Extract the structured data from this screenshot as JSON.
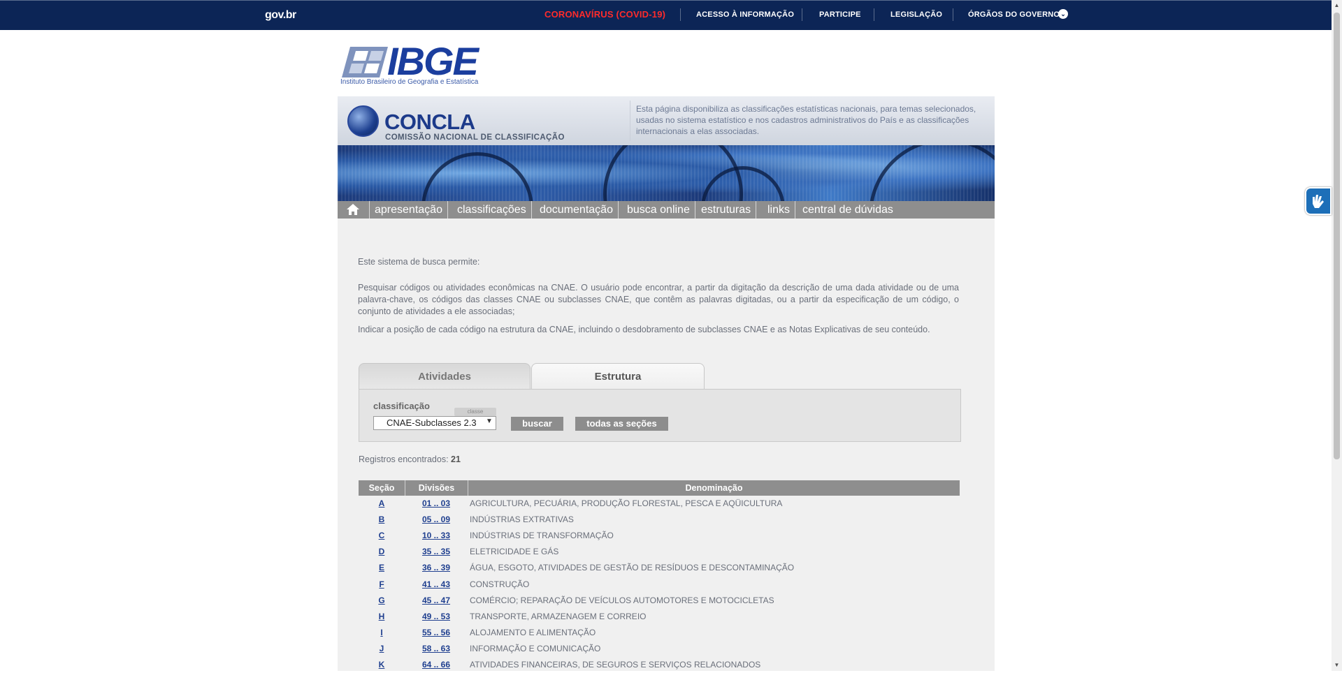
{
  "gov_bar": {
    "logo": "gov.br",
    "links": [
      "CORONAVÍRUS (COVID-19)",
      "ACESSO À INFORMAÇÃO",
      "PARTICIPE",
      "LEGISLAÇÃO",
      "ÓRGÃOS DO GOVERNO"
    ],
    "covid_color": "#ff2b2b",
    "bar_color": "#0c2556"
  },
  "ibge": {
    "name": "IBGE",
    "subtitle": "Instituto Brasileiro de Geografia e Estatística"
  },
  "concla": {
    "title": "CONCLA",
    "subtitle": "COMISSÃO NACIONAL DE CLASSIFICAÇÃO",
    "description": "Esta página disponibiliza as classificações estatísticas nacionais, para temas selecionados, usadas no sistema estatístico e nos cadastros administrativos do País e as classificações internacionais a elas associadas."
  },
  "nav": {
    "home_icon": "home-icon",
    "items": [
      "apresentação",
      "classificações",
      "documentação",
      "busca online",
      "estruturas",
      "links",
      "central de dúvidas"
    ]
  },
  "intro": {
    "p1": "Este sistema de busca permite:",
    "p2": "Pesquisar códigos ou atividades econômicas na CNAE. O usuário pode encontrar, a partir da digitação da descrição de uma dada atividade ou de uma palavra-chave, os códigos das classes CNAE ou subclasses CNAE, que contêm as palavras digitadas, ou a partir da especificação de um código, o conjunto de atividades a ele associadas;",
    "p3": "Indicar a posição de cada código na estrutura da CNAE, incluindo o desdobramento de subclasses CNAE e as Notas Explicativas de seu conteúdo."
  },
  "tabs": [
    "Atividades",
    "Estrutura"
  ],
  "active_tab": "Estrutura",
  "search": {
    "label": "classificação",
    "hint": "classe",
    "selected": "CNAE-Subclasses 2.3",
    "buscar": "buscar",
    "todas": "todas as seções"
  },
  "results": {
    "label": "Registros encontrados:",
    "count": "21",
    "headers": [
      "Seção",
      "Divisões",
      "Denominação"
    ],
    "rows": [
      {
        "secao": "A",
        "divisoes": "01 .. 03",
        "denominacao": "AGRICULTURA, PECUÁRIA, PRODUÇÃO FLORESTAL, PESCA E AQÜICULTURA"
      },
      {
        "secao": "B",
        "divisoes": "05 .. 09",
        "denominacao": "INDÚSTRIAS EXTRATIVAS"
      },
      {
        "secao": "C",
        "divisoes": "10 .. 33",
        "denominacao": "INDÚSTRIAS DE TRANSFORMAÇÃO"
      },
      {
        "secao": "D",
        "divisoes": "35 .. 35",
        "denominacao": "ELETRICIDADE E GÁS"
      },
      {
        "secao": "E",
        "divisoes": "36 .. 39",
        "denominacao": "ÁGUA, ESGOTO, ATIVIDADES DE GESTÃO DE RESÍDUOS E DESCONTAMINAÇÃO"
      },
      {
        "secao": "F",
        "divisoes": "41 .. 43",
        "denominacao": "CONSTRUÇÃO"
      },
      {
        "secao": "G",
        "divisoes": "45 .. 47",
        "denominacao": "COMÉRCIO; REPARAÇÃO DE VEÍCULOS AUTOMOTORES E MOTOCICLETAS"
      },
      {
        "secao": "H",
        "divisoes": "49 .. 53",
        "denominacao": "TRANSPORTE, ARMAZENAGEM E CORREIO"
      },
      {
        "secao": "I",
        "divisoes": "55 .. 56",
        "denominacao": "ALOJAMENTO E ALIMENTAÇÃO"
      },
      {
        "secao": "J",
        "divisoes": "58 .. 63",
        "denominacao": "INFORMAÇÃO E COMUNICAÇÃO"
      },
      {
        "secao": "K",
        "divisoes": "64 .. 66",
        "denominacao": "ATIVIDADES FINANCEIRAS, DE SEGUROS E SERVIÇOS RELACIONADOS"
      }
    ]
  },
  "accessibility_widget": "sign-language-icon"
}
